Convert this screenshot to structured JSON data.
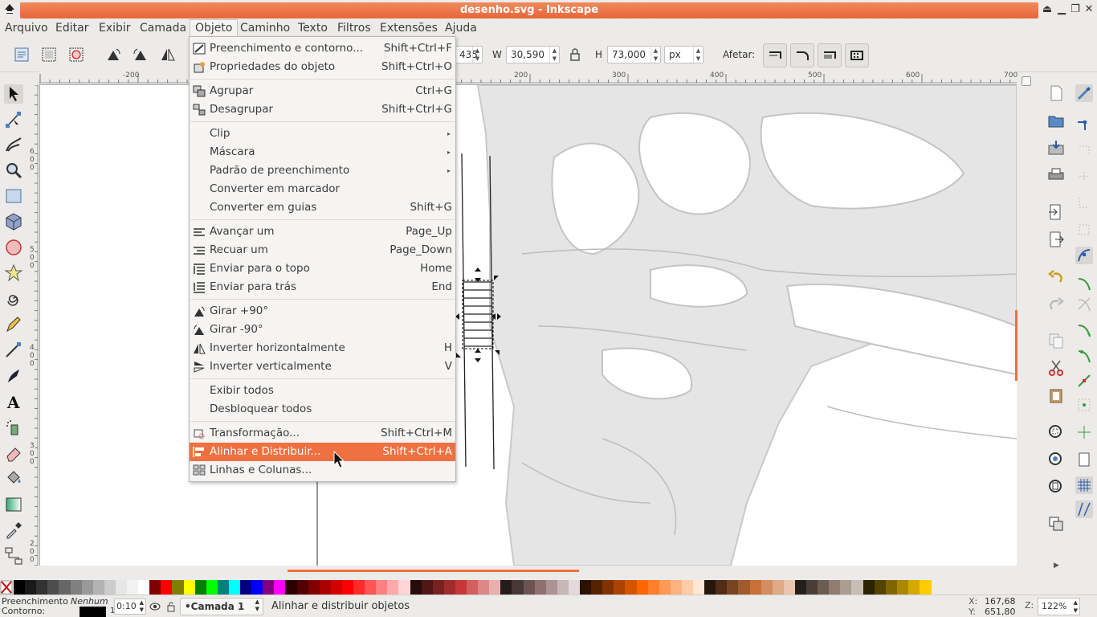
{
  "window": {
    "title": "desenho.svg - Inkscape"
  },
  "menubar": [
    "Arquivo",
    "Editar",
    "Exibir",
    "Camada",
    "Objeto",
    "Caminho",
    "Texto",
    "Filtros",
    "Extensões",
    "Ajuda"
  ],
  "controls": {
    "x_partial": "435",
    "w_label": "W",
    "w_value": "30,590",
    "h_label": "H",
    "h_value": "73,000",
    "unit": "px",
    "afetar_label": "Afetar:"
  },
  "hruler": [
    "-200",
    "200",
    "300",
    "400",
    "500",
    "600",
    "700"
  ],
  "vruler": [
    "6",
    "0",
    "0",
    "5",
    "0",
    "0",
    "4",
    "0",
    "0",
    "3",
    "0",
    "0",
    "2",
    "0",
    "0"
  ],
  "object_menu": {
    "g1": [
      {
        "label": "Preenchimento e contorno...",
        "shortcut": "Shift+Ctrl+F",
        "icon": "fill-stroke-icon"
      },
      {
        "label": "Propriedades do objeto",
        "shortcut": "Shift+Ctrl+O",
        "icon": "object-properties-icon"
      }
    ],
    "g2": [
      {
        "label": "Agrupar",
        "shortcut": "Ctrl+G",
        "icon": "group-icon"
      },
      {
        "label": "Desagrupar",
        "shortcut": "Shift+Ctrl+G",
        "icon": "ungroup-icon"
      }
    ],
    "g3": [
      {
        "label": "Clip",
        "shortcut": "",
        "submenu": true
      },
      {
        "label": "Máscara",
        "shortcut": "",
        "submenu": true
      },
      {
        "label": "Padrão de preenchimento",
        "shortcut": "",
        "submenu": true
      },
      {
        "label": "Converter em marcador",
        "shortcut": ""
      },
      {
        "label": "Converter em guias",
        "shortcut": "Shift+G"
      }
    ],
    "g4": [
      {
        "label": "Avançar um",
        "shortcut": "Page_Up",
        "icon": "raise-icon"
      },
      {
        "label": "Recuar um",
        "shortcut": "Page_Down",
        "icon": "lower-icon"
      },
      {
        "label": "Enviar para o topo",
        "shortcut": "Home",
        "icon": "raise-to-top-icon"
      },
      {
        "label": "Enviar para trás",
        "shortcut": "End",
        "icon": "lower-to-bottom-icon"
      }
    ],
    "g5": [
      {
        "label": "Girar +90°",
        "shortcut": "",
        "icon": "rotate-cw-icon"
      },
      {
        "label": "Girar -90°",
        "shortcut": "",
        "icon": "rotate-ccw-icon"
      },
      {
        "label": "Inverter horizontalmente",
        "shortcut": "H",
        "icon": "flip-horizontal-icon"
      },
      {
        "label": "Inverter verticalmente",
        "shortcut": "V",
        "icon": "flip-vertical-icon"
      }
    ],
    "g6": [
      {
        "label": "Exibir todos",
        "shortcut": ""
      },
      {
        "label": "Desbloquear todos",
        "shortcut": ""
      }
    ],
    "g7": [
      {
        "label": "Transformação...",
        "shortcut": "Shift+Ctrl+M",
        "icon": "transform-icon"
      },
      {
        "label": "Alinhar e Distribuir...",
        "shortcut": "Shift+Ctrl+A",
        "icon": "align-distribute-icon",
        "highlighted": true
      },
      {
        "label": "Linhas e Colunas...",
        "shortcut": "",
        "icon": "rows-columns-icon"
      }
    ]
  },
  "status": {
    "fill_label": "Preenchimento",
    "fill_value": "Nenhum",
    "stroke_label": "Contorno:",
    "stroke_width": "1",
    "opacity": "0:10",
    "layer": "•Camada 1",
    "message": "Alinhar e distribuir objetos",
    "x_label": "X:",
    "x_value": "167,68",
    "y_label": "Y:",
    "y_value": "651,80",
    "zoom_label": "Z:",
    "zoom_value": "122%"
  },
  "colors": {
    "accent": "#ef7040",
    "title_gradient_top": "#f08a5c",
    "title_gradient_bottom": "#e8663a"
  }
}
